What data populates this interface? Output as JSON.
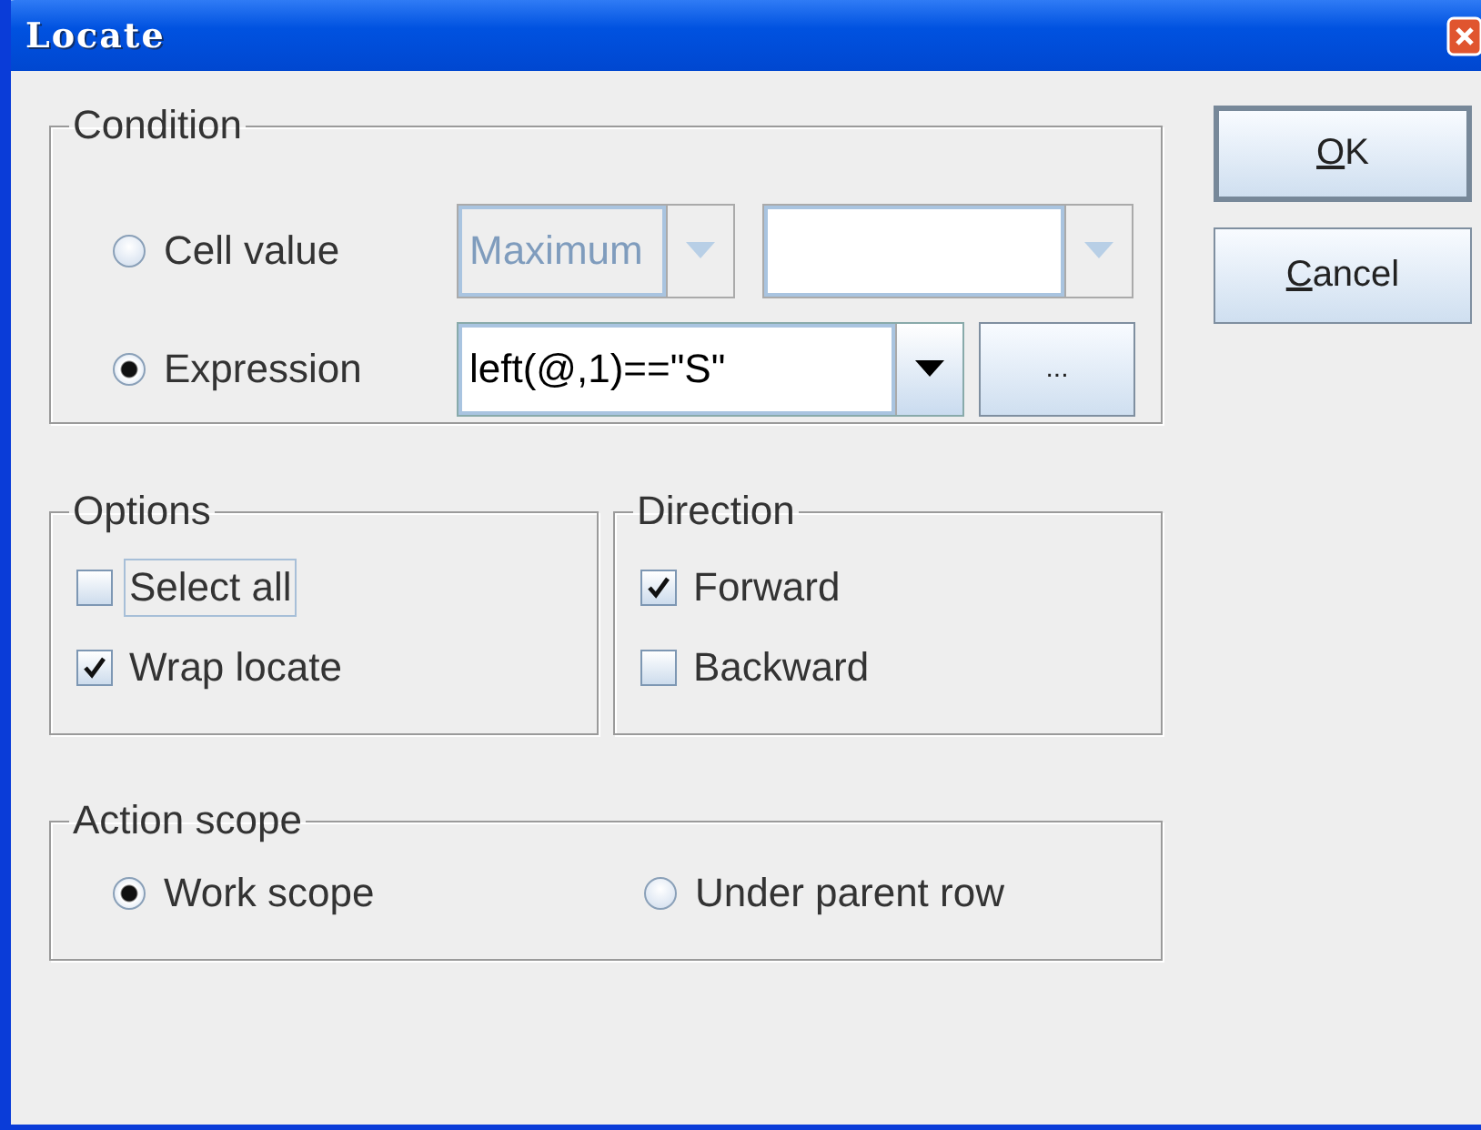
{
  "window": {
    "title": "Locate"
  },
  "condition": {
    "label": "Condition",
    "rows": [
      {
        "kind": "cell_value",
        "label": "Cell value",
        "selected": false,
        "fields": [
          {
            "value": "Maximum",
            "disabled": true
          },
          {
            "disabled": true
          }
        ]
      },
      {
        "kind": "expression",
        "label": "Expression",
        "selected": true,
        "field": {
          "value": "left(@,1)==\"S\"",
          "disabled": false
        },
        "button": "..."
      }
    ]
  },
  "options": {
    "label": "Options",
    "items": [
      {
        "label": "Select all",
        "checked": false,
        "focused": true
      },
      {
        "label": "Wrap locate",
        "checked": true,
        "focused": false
      }
    ]
  },
  "direction": {
    "label": "Direction",
    "items": [
      {
        "label": "Forward",
        "checked": true,
        "focused": false
      },
      {
        "label": "Backward",
        "checked": false,
        "focused": false
      }
    ]
  },
  "action_scope": {
    "label": "Action scope",
    "items": [
      {
        "label": "Work scope",
        "selected": true
      },
      {
        "label": "Under parent row",
        "selected": false
      }
    ]
  },
  "buttons": [
    {
      "label": "OK",
      "default": true,
      "mnemonic_first": true
    },
    {
      "label": "Cancel",
      "default": false,
      "mnemonic_first": true
    }
  ]
}
